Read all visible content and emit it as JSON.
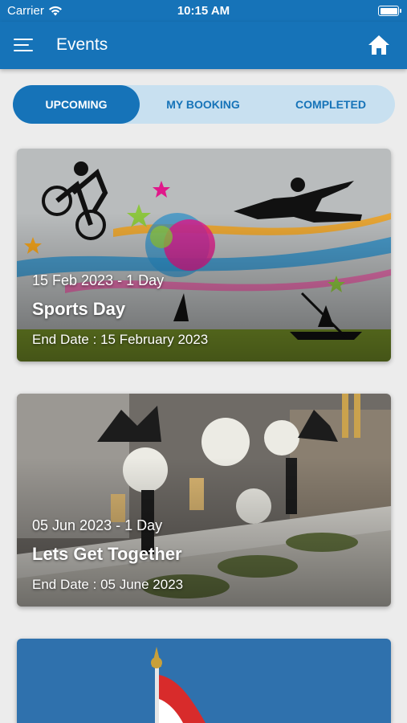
{
  "status_bar": {
    "carrier": "Carrier",
    "time": "10:15 AM"
  },
  "header": {
    "title": "Events",
    "menu_icon": "hamburger-menu-icon",
    "home_icon": "home-icon"
  },
  "tabs": [
    {
      "label": "UPCOMING",
      "active": true
    },
    {
      "label": "MY BOOKING",
      "active": false
    },
    {
      "label": "COMPLETED",
      "active": false
    }
  ],
  "events": [
    {
      "date_line": "15 Feb 2023 - 1 Day",
      "name": "Sports Day",
      "end_label": "End Date : ",
      "end_date": "15 February 2023"
    },
    {
      "date_line": "05 Jun 2023 - 1 Day",
      "name": "Lets Get Together",
      "end_label": "End Date : ",
      "end_date": "05 June 2023"
    }
  ],
  "colors": {
    "primary": "#1673b8",
    "tab_bg": "#c8e0f0",
    "background": "#ececec"
  }
}
